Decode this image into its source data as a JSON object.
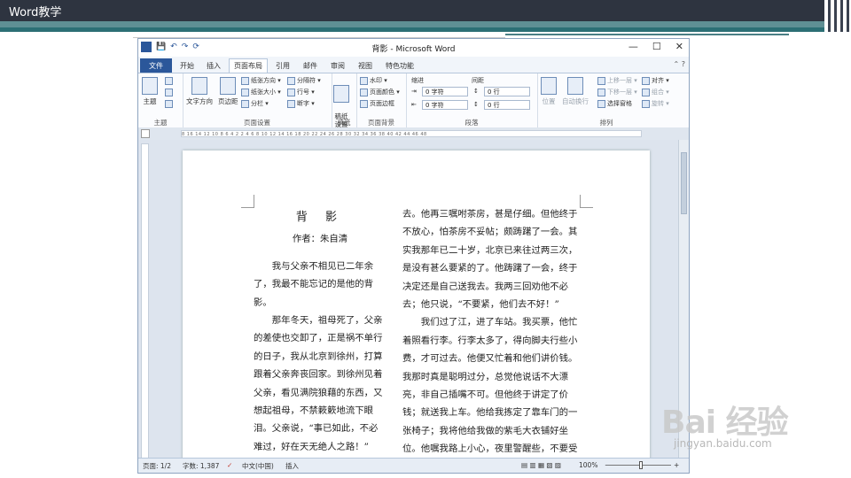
{
  "slide": {
    "header_title": "Word教学"
  },
  "window": {
    "title": "背影 - Microsoft Word",
    "controls": [
      "—",
      "☐",
      "✕"
    ],
    "qat": [
      "💾",
      "↶",
      "↷",
      "⟳"
    ]
  },
  "tabs": [
    "文件",
    "开始",
    "插入",
    "页面布局",
    "引用",
    "邮件",
    "审阅",
    "视图",
    "特色功能"
  ],
  "active_tab": "页面布局",
  "ribbon": {
    "theme_group": {
      "label": "主题",
      "big_button": "主题"
    },
    "page_setup": {
      "label": "页面设置",
      "text_direction": "文字方向",
      "margins": "页边距",
      "orientation": "纸张方向",
      "size": "纸张大小",
      "columns": "分栏",
      "breaks": "分隔符",
      "line_numbers": "行号",
      "hyphenation": "断字"
    },
    "manuscript": {
      "label": "稿纸",
      "button": "稿纸\n设置"
    },
    "page_background": {
      "label": "页面背景",
      "watermark": "水印",
      "page_color": "页面颜色",
      "page_borders": "页面边框"
    },
    "paragraph": {
      "label": "段落",
      "indent_title": "缩进",
      "spacing_title": "间距",
      "indent_left": "0 字符",
      "indent_right": "0 字符",
      "spacing_before": "0 行",
      "spacing_after": "0 行"
    },
    "arrange": {
      "label": "排列",
      "position": "位置",
      "wrap": "自动换行",
      "bring_forward": "上移一层",
      "send_backward": "下移一层",
      "selection_pane": "选择窗格",
      "align": "对齐",
      "group": "组合",
      "rotate": "旋转"
    }
  },
  "ruler_text": "8  16  14  12  10  8  6  4  2    2  4  6  8  10  12  14  16  18  20  22  24  26  28  30  32  34  36  38  40  42  44  46  48",
  "document": {
    "title": "背 影",
    "author": "作者：朱自清",
    "left_column": [
      "我与父亲不相见已二年余了，我最不能忘记的是他的背影。",
      "那年冬天，祖母死了，父亲的差使也交卸了，正是祸不单行的日子，我从北京到徐州，打算跟着父亲奔丧回家。到徐州见着父亲，看见满院狼藉的东西，又想起祖母，不禁簌簌地流下眼泪。父亲说，“事已如此，不必难过，好在天无绝人之路！”"
    ],
    "right_column": [
      "去。他再三嘱咐茶房，甚是仔细。但他终于不放心，怕茶房不妥帖；颇踌躇了一会。其实我那年已二十岁，北京已来往过两三次，是没有甚么要紧的了。他踌躇了一会，终于决定还是自己送我去。我两三回劝他不必去；他只说，“不要紧，他们去不好！”",
      "我们过了江，进了车站。我买票，他忙着照看行李。行李太多了，得向脚夫行些小费，才可过去。他便又忙着和他们讲价钱。我那时真是聪明过分，总觉他说话不大漂亮，非自己插嘴不可。但他终于讲定了价钱；就送我上车。他给我拣定了靠车门的一张椅子；我将他给我做的紫毛大衣铺好坐位。他嘱我路上小心，夜里警醒些，不要受凉。又"
    ]
  },
  "status": {
    "page": "页面: 1/2",
    "words": "字数: 1,387",
    "language": "中文(中国)",
    "mode": "插入",
    "zoom": "100%",
    "zoom_minus": "−",
    "zoom_plus": "+"
  },
  "watermark": {
    "text": "Bai 经验",
    "url": "jingyan.baidu.com"
  }
}
